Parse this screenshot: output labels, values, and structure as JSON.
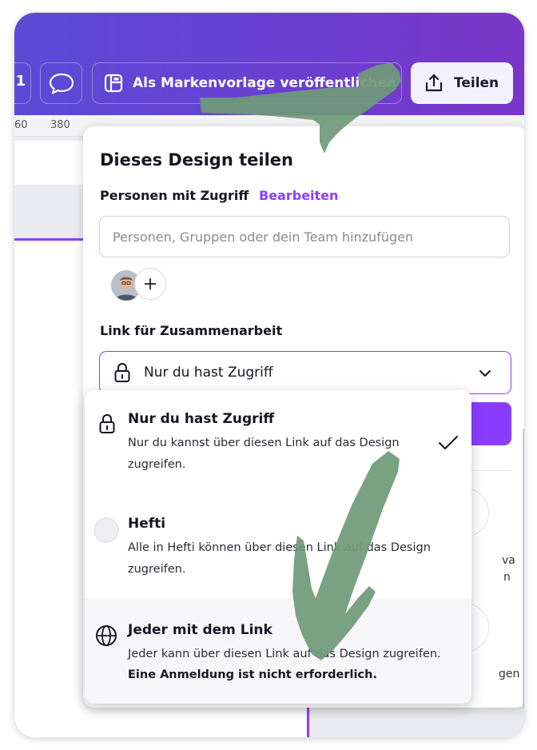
{
  "toolbar": {
    "partial_label": "1",
    "publish_template_label": "Als Markenvorlage veröffentlichen",
    "share_label": "Teilen"
  },
  "ruler": {
    "ticks": [
      "60",
      "380"
    ]
  },
  "share_panel": {
    "title": "Dieses Design teilen",
    "people_access_label": "Personen mit Zugriff",
    "edit_link": "Bearbeiten",
    "people_input_placeholder": "Personen, Gruppen oder dein Team hinzufügen",
    "collab_link_label": "Link für Zusammenarbeit",
    "selected_access": "Nur du hast Zugriff"
  },
  "access_options": [
    {
      "title": "Nur du hast Zugriff",
      "description": "Nur du kannst über diesen Link auf das Design zugreifen.",
      "selected": true
    },
    {
      "title": "Hefti",
      "description": "Alle in Hefti können über diesen Link auf das Design zugreifen.",
      "selected": false
    },
    {
      "title": "Jeder mit dem Link",
      "description": "Jeder kann über diesen Link auf das Design zugreifen.",
      "note": "Eine Anmeldung ist nicht erforderlich.",
      "selected": false
    }
  ],
  "background_fragments": [
    "va",
    "n",
    "gen"
  ],
  "colors": {
    "accent": "#8b3dff",
    "topbar_start": "#5a4bd6",
    "topbar_end": "#7a36c8",
    "annotation_arrow": "#6f9a79"
  },
  "icons": [
    "comment-icon",
    "template-icon",
    "share-upload-icon",
    "plus-icon",
    "lock-icon",
    "chevron-down-icon",
    "checkmark-icon",
    "team-logo-icon",
    "globe-icon"
  ]
}
